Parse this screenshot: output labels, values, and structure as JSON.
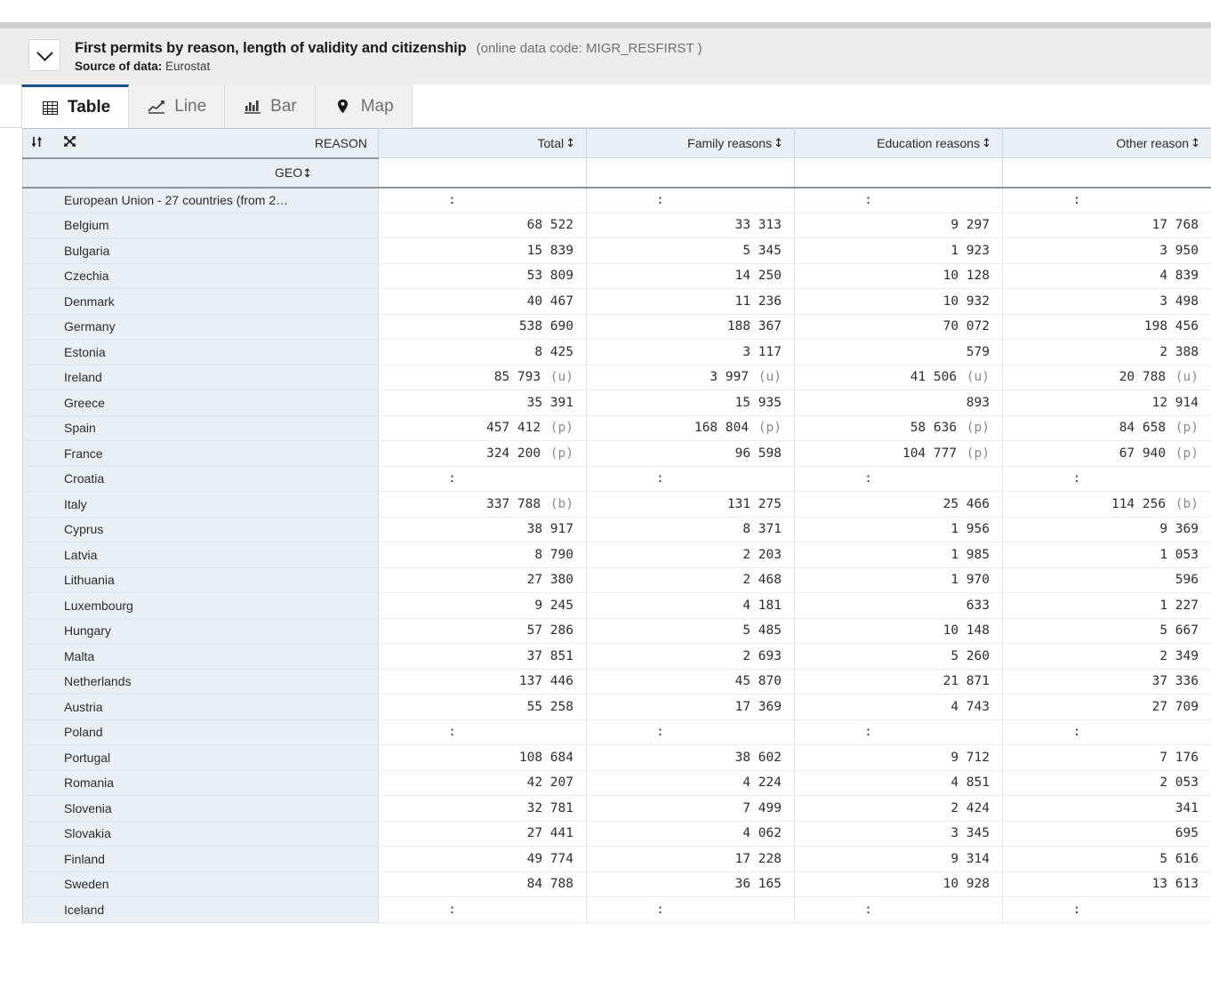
{
  "header": {
    "collapse_icon": "chevron-down-icon",
    "title": "First permits by reason, length of validity and citizenship",
    "data_code": "(online data code: MIGR_RESFIRST )",
    "source_label": "Source of data:",
    "source_value": "Eurostat"
  },
  "tabs": [
    {
      "label": "Table",
      "icon": "table-icon",
      "active": true
    },
    {
      "label": "Line",
      "icon": "line-chart-icon",
      "active": false
    },
    {
      "label": "Bar",
      "icon": "bar-chart-icon",
      "active": false
    },
    {
      "label": "Map",
      "icon": "map-pin-icon",
      "active": false
    }
  ],
  "table": {
    "toolbar_icons": [
      "sort-icon",
      "transpose-icon"
    ],
    "dimension_col_label": "REASON",
    "row_dimension_label": "GEO",
    "sort_glyph": "↕",
    "columns": [
      "Total",
      "Family reasons",
      "Education reasons",
      "Other reason"
    ],
    "missing_symbol": ":",
    "rows": [
      {
        "geo": "European Union - 27 countries (from 2…",
        "values": [
          ":",
          ":",
          ":",
          ":"
        ],
        "flags": [
          "",
          "",
          "",
          ""
        ]
      },
      {
        "geo": "Belgium",
        "values": [
          "68 522",
          "33 313",
          "9 297",
          "17 768"
        ],
        "flags": [
          "",
          "",
          "",
          ""
        ]
      },
      {
        "geo": "Bulgaria",
        "values": [
          "15 839",
          "5 345",
          "1 923",
          "3 950"
        ],
        "flags": [
          "",
          "",
          "",
          ""
        ]
      },
      {
        "geo": "Czechia",
        "values": [
          "53 809",
          "14 250",
          "10 128",
          "4 839"
        ],
        "flags": [
          "",
          "",
          "",
          ""
        ]
      },
      {
        "geo": "Denmark",
        "values": [
          "40 467",
          "11 236",
          "10 932",
          "3 498"
        ],
        "flags": [
          "",
          "",
          "",
          ""
        ]
      },
      {
        "geo": "Germany",
        "values": [
          "538 690",
          "188 367",
          "70 072",
          "198 456"
        ],
        "flags": [
          "",
          "",
          "",
          ""
        ]
      },
      {
        "geo": "Estonia",
        "values": [
          "8 425",
          "3 117",
          "579",
          "2 388"
        ],
        "flags": [
          "",
          "",
          "",
          ""
        ]
      },
      {
        "geo": "Ireland",
        "values": [
          "85 793",
          "3 997",
          "41 506",
          "20 788"
        ],
        "flags": [
          "(u)",
          "(u)",
          "(u)",
          "(u)"
        ]
      },
      {
        "geo": "Greece",
        "values": [
          "35 391",
          "15 935",
          "893",
          "12 914"
        ],
        "flags": [
          "",
          "",
          "",
          ""
        ]
      },
      {
        "geo": "Spain",
        "values": [
          "457 412",
          "168 804",
          "58 636",
          "84 658"
        ],
        "flags": [
          "(p)",
          "(p)",
          "(p)",
          "(p)"
        ]
      },
      {
        "geo": "France",
        "values": [
          "324 200",
          "96 598",
          "104 777",
          "67 940"
        ],
        "flags": [
          "(p)",
          "",
          "(p)",
          "(p)"
        ]
      },
      {
        "geo": "Croatia",
        "values": [
          ":",
          ":",
          ":",
          ":"
        ],
        "flags": [
          "",
          "",
          "",
          ""
        ]
      },
      {
        "geo": "Italy",
        "values": [
          "337 788",
          "131 275",
          "25 466",
          "114 256"
        ],
        "flags": [
          "(b)",
          "",
          "",
          "(b)"
        ]
      },
      {
        "geo": "Cyprus",
        "values": [
          "38 917",
          "8 371",
          "1 956",
          "9 369"
        ],
        "flags": [
          "",
          "",
          "",
          ""
        ]
      },
      {
        "geo": "Latvia",
        "values": [
          "8 790",
          "2 203",
          "1 985",
          "1 053"
        ],
        "flags": [
          "",
          "",
          "",
          ""
        ]
      },
      {
        "geo": "Lithuania",
        "values": [
          "27 380",
          "2 468",
          "1 970",
          "596"
        ],
        "flags": [
          "",
          "",
          "",
          ""
        ]
      },
      {
        "geo": "Luxembourg",
        "values": [
          "9 245",
          "4 181",
          "633",
          "1 227"
        ],
        "flags": [
          "",
          "",
          "",
          ""
        ]
      },
      {
        "geo": "Hungary",
        "values": [
          "57 286",
          "5 485",
          "10 148",
          "5 667"
        ],
        "flags": [
          "",
          "",
          "",
          ""
        ]
      },
      {
        "geo": "Malta",
        "values": [
          "37 851",
          "2 693",
          "5 260",
          "2 349"
        ],
        "flags": [
          "",
          "",
          "",
          ""
        ]
      },
      {
        "geo": "Netherlands",
        "values": [
          "137 446",
          "45 870",
          "21 871",
          "37 336"
        ],
        "flags": [
          "",
          "",
          "",
          ""
        ]
      },
      {
        "geo": "Austria",
        "values": [
          "55 258",
          "17 369",
          "4 743",
          "27 709"
        ],
        "flags": [
          "",
          "",
          "",
          ""
        ]
      },
      {
        "geo": "Poland",
        "values": [
          ":",
          ":",
          ":",
          ":"
        ],
        "flags": [
          "",
          "",
          "",
          ""
        ]
      },
      {
        "geo": "Portugal",
        "values": [
          "108 684",
          "38 602",
          "9 712",
          "7 176"
        ],
        "flags": [
          "",
          "",
          "",
          ""
        ]
      },
      {
        "geo": "Romania",
        "values": [
          "42 207",
          "4 224",
          "4 851",
          "2 053"
        ],
        "flags": [
          "",
          "",
          "",
          ""
        ]
      },
      {
        "geo": "Slovenia",
        "values": [
          "32 781",
          "7 499",
          "2 424",
          "341"
        ],
        "flags": [
          "",
          "",
          "",
          ""
        ]
      },
      {
        "geo": "Slovakia",
        "values": [
          "27 441",
          "4 062",
          "3 345",
          "695"
        ],
        "flags": [
          "",
          "",
          "",
          ""
        ]
      },
      {
        "geo": "Finland",
        "values": [
          "49 774",
          "17 228",
          "9 314",
          "5 616"
        ],
        "flags": [
          "",
          "",
          "",
          ""
        ]
      },
      {
        "geo": "Sweden",
        "values": [
          "84 788",
          "36 165",
          "10 928",
          "13 613"
        ],
        "flags": [
          "",
          "",
          "",
          ""
        ]
      },
      {
        "geo": "Iceland",
        "values": [
          ":",
          ":",
          ":",
          ":"
        ],
        "flags": [
          "",
          "",
          "",
          ""
        ]
      }
    ]
  },
  "colors": {
    "accent": "#1d4f91",
    "header_bg": "#ededed",
    "dim_header_bg": "#eaeff3",
    "flag_text": "#8a8a8a"
  }
}
